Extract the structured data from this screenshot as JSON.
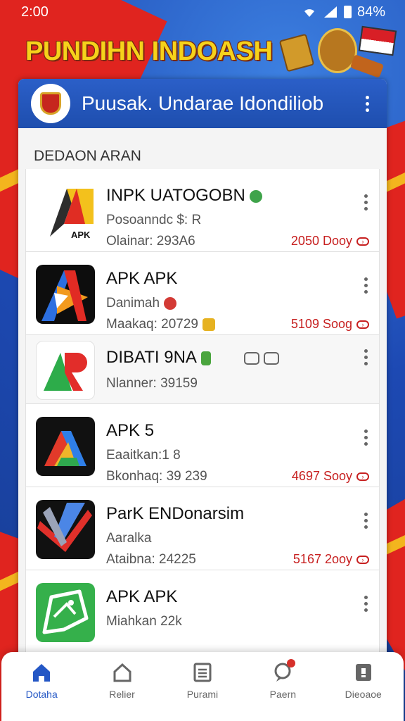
{
  "status": {
    "time": "2:00",
    "battery": "84%"
  },
  "banner": {
    "text": "PUNDIHN INDOASH"
  },
  "appbar": {
    "title": "Puusak. Undarae Idondiliob"
  },
  "section": {
    "header": "DEDAON ARAN"
  },
  "items": [
    {
      "name": "INPK UATOGOBN",
      "line2": "Posoanndc $: R",
      "line3": "Olainar: 293A6",
      "size": "2050 Dooy",
      "icon": "apk-a-red-yellow",
      "icon_label": "APK"
    },
    {
      "name": "APK APK",
      "line2": "Danimah",
      "line3": "Maakaq: 20729",
      "size": "5109 Soog",
      "icon": "apk-a-flame"
    },
    {
      "name": "DIBATI 9NA",
      "line2": "",
      "line3": "Nlanner: 39159",
      "size": "",
      "icon": "ap-green-red"
    },
    {
      "name": "APK 5",
      "line2": "Eaaitkan:1 8",
      "line3": "Bkonhaq: 39 239",
      "size": "4697 Sooy",
      "icon": "apk-a-colorful"
    },
    {
      "name": "ParK ENDonarsim",
      "line2": "Aaralka",
      "line3": "Ataibna: 24225",
      "size": "5167 2ooy",
      "icon": "apk-x-red"
    },
    {
      "name": "APK APK",
      "line2": "Miahkan 22k",
      "line3": "",
      "size": "",
      "icon": "apk-green-bubble"
    }
  ],
  "nav": [
    {
      "label": "Dotaha",
      "icon": "home-icon"
    },
    {
      "label": "Relier",
      "icon": "house-outline-icon"
    },
    {
      "label": "Purami",
      "icon": "list-icon"
    },
    {
      "label": "Paern",
      "icon": "chat-icon"
    },
    {
      "label": "Dieoaoe",
      "icon": "profile-card-icon"
    }
  ],
  "colors": {
    "primary": "#2457c5",
    "accent_red": "#c72020",
    "banner_gold": "#f6d21b"
  }
}
